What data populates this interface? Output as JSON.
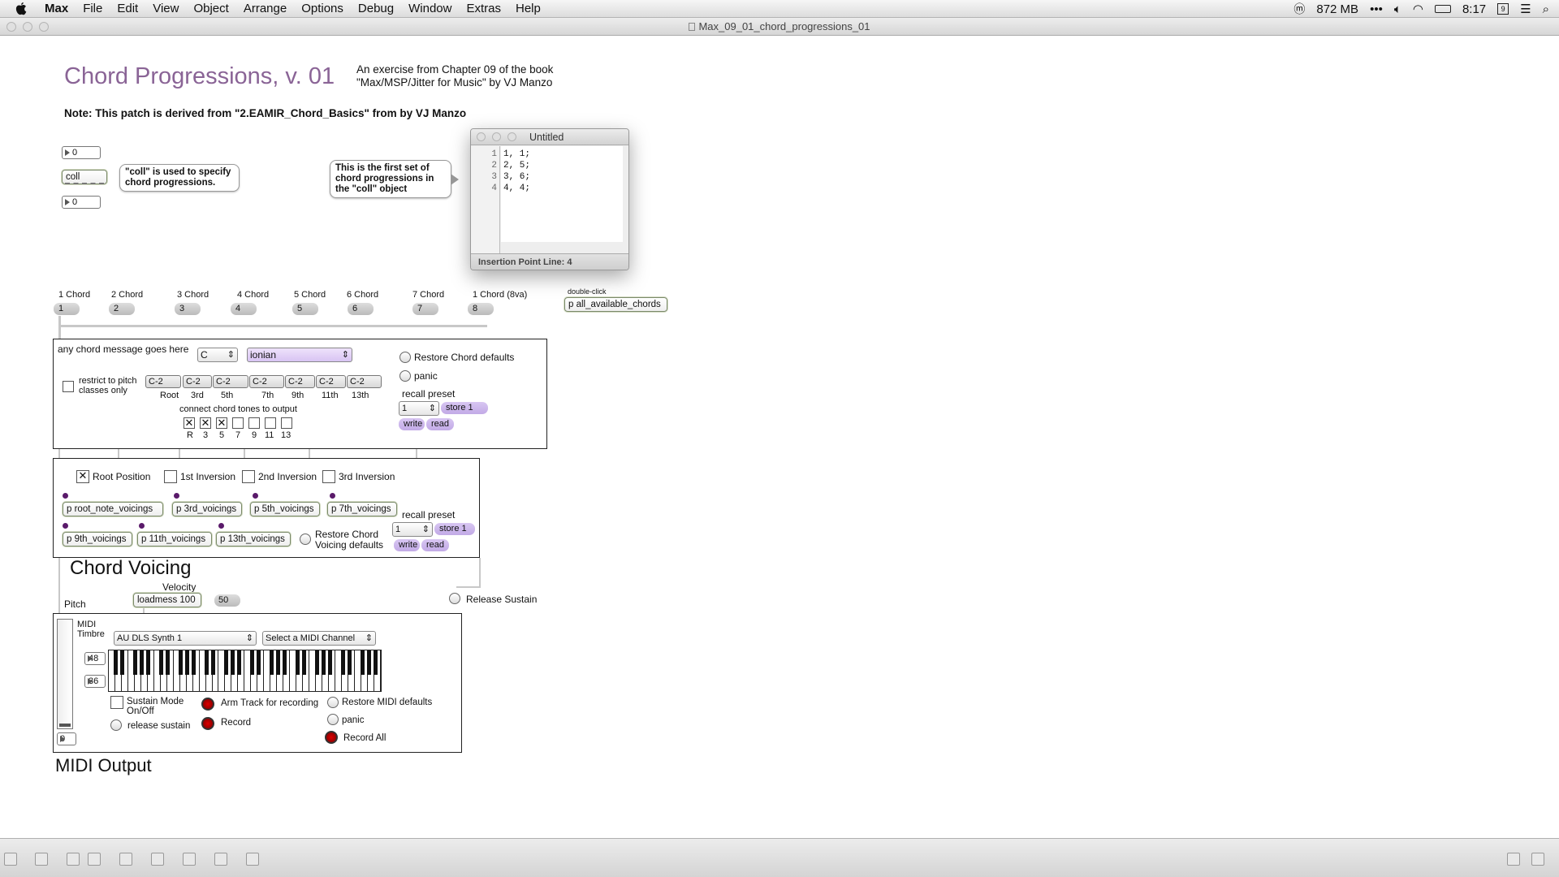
{
  "menubar": {
    "app": "Max",
    "items": [
      "File",
      "Edit",
      "View",
      "Object",
      "Arrange",
      "Options",
      "Debug",
      "Window",
      "Extras",
      "Help"
    ],
    "memory": "872 MB",
    "clock": "8:17"
  },
  "window": {
    "title": "Max_09_01_chord_progressions_01"
  },
  "header": {
    "title": "Chord Progressions, v. 01",
    "subtitle_1": "An exercise from Chapter 09 of the book",
    "subtitle_2": "\"Max/MSP/Jitter for Music\" by VJ Manzo",
    "note": "Note: This patch is derived from \"2.EAMIR_Chord_Basics\" from by VJ Manzo"
  },
  "coll_section": {
    "number_top": "0",
    "coll_label": "coll",
    "number_bottom": "0",
    "coll_bubble": "\"coll\" is used to specify chord progressions.",
    "first_set_bubble": "This is the first set of chord progressions in the \"coll\" object"
  },
  "editor": {
    "title": "Untitled",
    "line_numbers": [
      "1",
      "2",
      "3",
      "4"
    ],
    "lines": [
      "1, 1;",
      "2, 5;",
      "3, 6;",
      "4, 4;"
    ],
    "status": "Insertion Point Line: 4"
  },
  "chord_buttons": [
    {
      "label": "1 Chord",
      "value": "1"
    },
    {
      "label": "2 Chord",
      "value": "2"
    },
    {
      "label": "3 Chord",
      "value": "3"
    },
    {
      "label": "4 Chord",
      "value": "4"
    },
    {
      "label": "5 Chord",
      "value": "5"
    },
    {
      "label": "6 Chord",
      "value": "6"
    },
    {
      "label": "7 Chord",
      "value": "7"
    },
    {
      "label": "1 Chord (8va)",
      "value": "8"
    }
  ],
  "all_chords": {
    "hint": "double-click",
    "object": "p all_available_chords"
  },
  "chord_panel": {
    "message_label": "any chord message goes here",
    "root_note": "C",
    "mode": "ionian",
    "restrict_label_1": "restrict to pitch",
    "restrict_label_2": "classes only",
    "notes": [
      "C-2",
      "C-2",
      "C-2",
      "C-2",
      "C-2",
      "C-2",
      "C-2"
    ],
    "note_labels": [
      "Root",
      "3rd",
      "5th",
      "7th",
      "9th",
      "11th",
      "13th"
    ],
    "connect_label": "connect chord tones to output",
    "tones": [
      {
        "label": "R",
        "checked": true
      },
      {
        "label": "3",
        "checked": true
      },
      {
        "label": "5",
        "checked": true
      },
      {
        "label": "7",
        "checked": false
      },
      {
        "label": "9",
        "checked": false
      },
      {
        "label": "11",
        "checked": false
      },
      {
        "label": "13",
        "checked": false
      }
    ],
    "restore_defaults": "Restore Chord defaults",
    "panic": "panic",
    "recall_preset": "recall preset",
    "preset_value": "1",
    "store": "store 1",
    "write": "write",
    "read": "read"
  },
  "voicing_panel": {
    "inversions": [
      {
        "label": "Root Position",
        "checked": true
      },
      {
        "label": "1st Inversion",
        "checked": false
      },
      {
        "label": "2nd Inversion",
        "checked": false
      },
      {
        "label": "3rd Inversion",
        "checked": false
      }
    ],
    "voicings_row1": [
      "p root_note_voicings",
      "p 3rd_voicings",
      "p 5th_voicings",
      "p 7th_voicings"
    ],
    "voicings_row2": [
      "p 9th_voicings",
      "p 11th_voicings",
      "p 13th_voicings"
    ],
    "restore_1": "Restore Chord",
    "restore_2": "Voicing defaults",
    "recall_preset": "recall preset",
    "preset_value": "1",
    "store": "store 1",
    "write": "write",
    "read": "read",
    "title": "Chord Voicing"
  },
  "velocity": {
    "label": "Velocity",
    "loadmess": "loadmess 100",
    "value": "50",
    "pitch_label": "Pitch",
    "release_sustain": "Release Sustain"
  },
  "midi_panel": {
    "timbre_1": "MIDI",
    "timbre_2": "Timbre",
    "synth": "AU DLS Synth 1",
    "channel": "Select a MIDI Channel",
    "num_48": "48",
    "num_36": "36",
    "slider_value": "0",
    "sustain_1": "Sustain Mode",
    "sustain_2": "On/Off",
    "release_sustain": "release sustain",
    "arm_track": "Arm Track for recording",
    "record": "Record",
    "restore_midi": "Restore MIDI defaults",
    "panic": "panic",
    "record_all": "Record All",
    "title": "MIDI Output"
  }
}
